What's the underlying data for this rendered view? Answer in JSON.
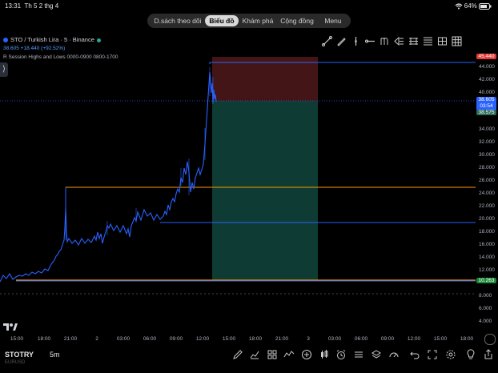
{
  "status_bar": {
    "time": "13:31",
    "date": "Th 5 2 thg 4",
    "battery": "64%"
  },
  "nav": {
    "tabs": [
      "D.sách theo dõi",
      "Biểu đồ",
      "Khám phá",
      "Cộng đồng",
      "Menu"
    ],
    "active": "Biểu đồ"
  },
  "symbol": {
    "title": "STO / Turkish Lira · 5 · Binance",
    "change": "38.605 +18.440 (+92.52%)",
    "indicator": "R Session Highs and Lows 0000-0900 0800-1700"
  },
  "drawing_tools": [
    "trend-line-icon",
    "brush-icon",
    "vertical-line-icon",
    "horizontal-ray-icon",
    "fork-icon",
    "long-position-icon",
    "short-position-icon",
    "fib-icon",
    "range-icon",
    "grid-icon"
  ],
  "price_tags": {
    "stop": "45.440",
    "current": "38.605",
    "countdown": "03:54",
    "entry": "38.575",
    "low": "10.263"
  },
  "y_axis": [
    "44.000",
    "42.000",
    "40.000",
    "38.000",
    "36.000",
    "34.000",
    "32.000",
    "30.000",
    "28.000",
    "26.000",
    "24.000",
    "22.000",
    "20.000",
    "18.000",
    "16.000",
    "14.000",
    "12.000",
    "10.000",
    "8.000",
    "6.000",
    "4.000"
  ],
  "x_axis": [
    "15:00",
    "18:00",
    "21:00",
    "2",
    "03:00",
    "06:00",
    "09:00",
    "12:00",
    "15:00",
    "18:00",
    "21:00",
    "3",
    "03:00",
    "06:00",
    "09:00",
    "12:00",
    "15:00",
    "18:00"
  ],
  "colors": {
    "line": "#2962ff",
    "orange": "#ff9800",
    "profit": "#0e3b33",
    "loss": "#431516",
    "accent": "#2962ff"
  },
  "bottom": {
    "ticker": "STOTRY",
    "ticker_sub": "EURUSD",
    "timeframe": "5m"
  },
  "bottom_icons": [
    "pencil-icon",
    "chart-type-icon",
    "indicators-icon",
    "wave-icon",
    "add-icon",
    "candles-icon",
    "alarm-icon",
    "timeline-icon",
    "layers-icon",
    "speed-icon",
    "undo-icon",
    "fullscreen-icon",
    "settings-icon",
    "bulb-icon",
    "share-icon"
  ]
}
